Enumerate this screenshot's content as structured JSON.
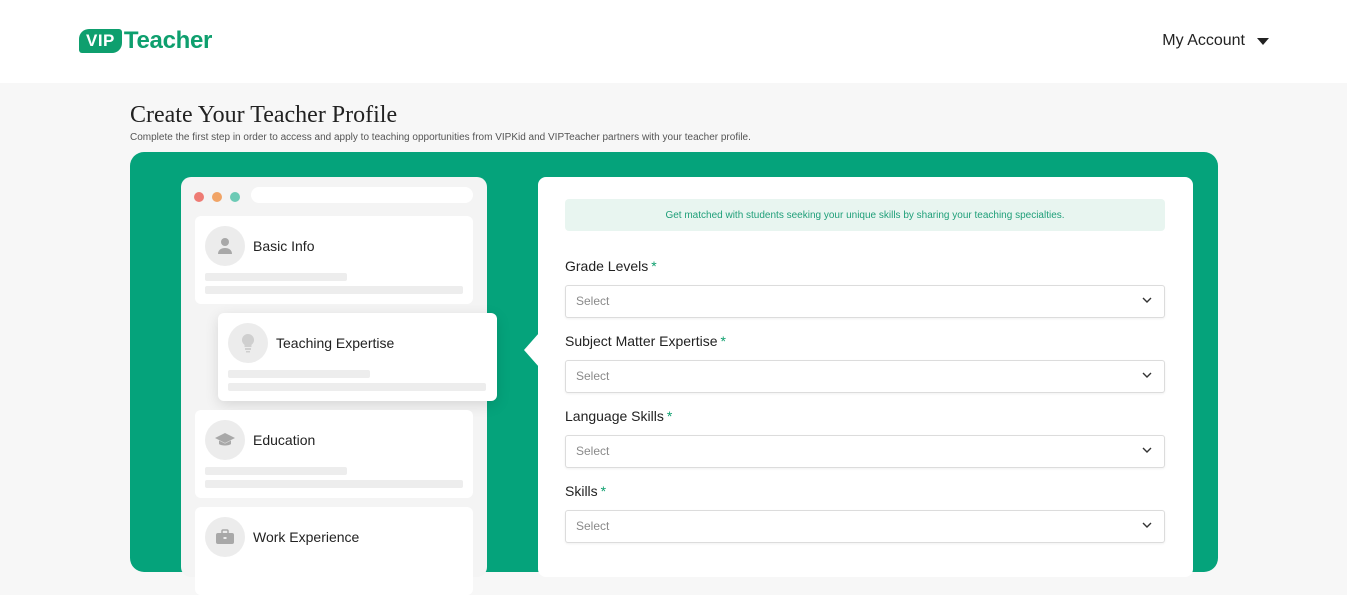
{
  "header": {
    "logo_badge": "VIP",
    "logo_text": "Teacher",
    "account_label": "My Account"
  },
  "page": {
    "title": "Create Your Teacher Profile",
    "subtitle": "Complete the first step in order to access and apply to teaching opportunities from VIPKid and VIPTeacher partners with your teacher profile."
  },
  "steps": [
    {
      "label": "Basic Info",
      "icon": "person-icon",
      "active": false
    },
    {
      "label": "Teaching Expertise",
      "icon": "lightbulb-icon",
      "active": true
    },
    {
      "label": "Education",
      "icon": "graduation-cap-icon",
      "active": false
    },
    {
      "label": "Work Experience",
      "icon": "briefcase-icon",
      "active": false
    }
  ],
  "form": {
    "banner": "Get matched with students seeking your unique skills by sharing your teaching specialties.",
    "required_mark": "*",
    "fields": [
      {
        "label": "Grade Levels",
        "placeholder": "Select"
      },
      {
        "label": "Subject Matter Expertise",
        "placeholder": "Select"
      },
      {
        "label": "Language Skills",
        "placeholder": "Select"
      },
      {
        "label": "Skills",
        "placeholder": "Select"
      }
    ]
  },
  "colors": {
    "brand": "#0e9f6e",
    "panel": "#05a37b",
    "banner_bg": "#e8f5f0"
  }
}
